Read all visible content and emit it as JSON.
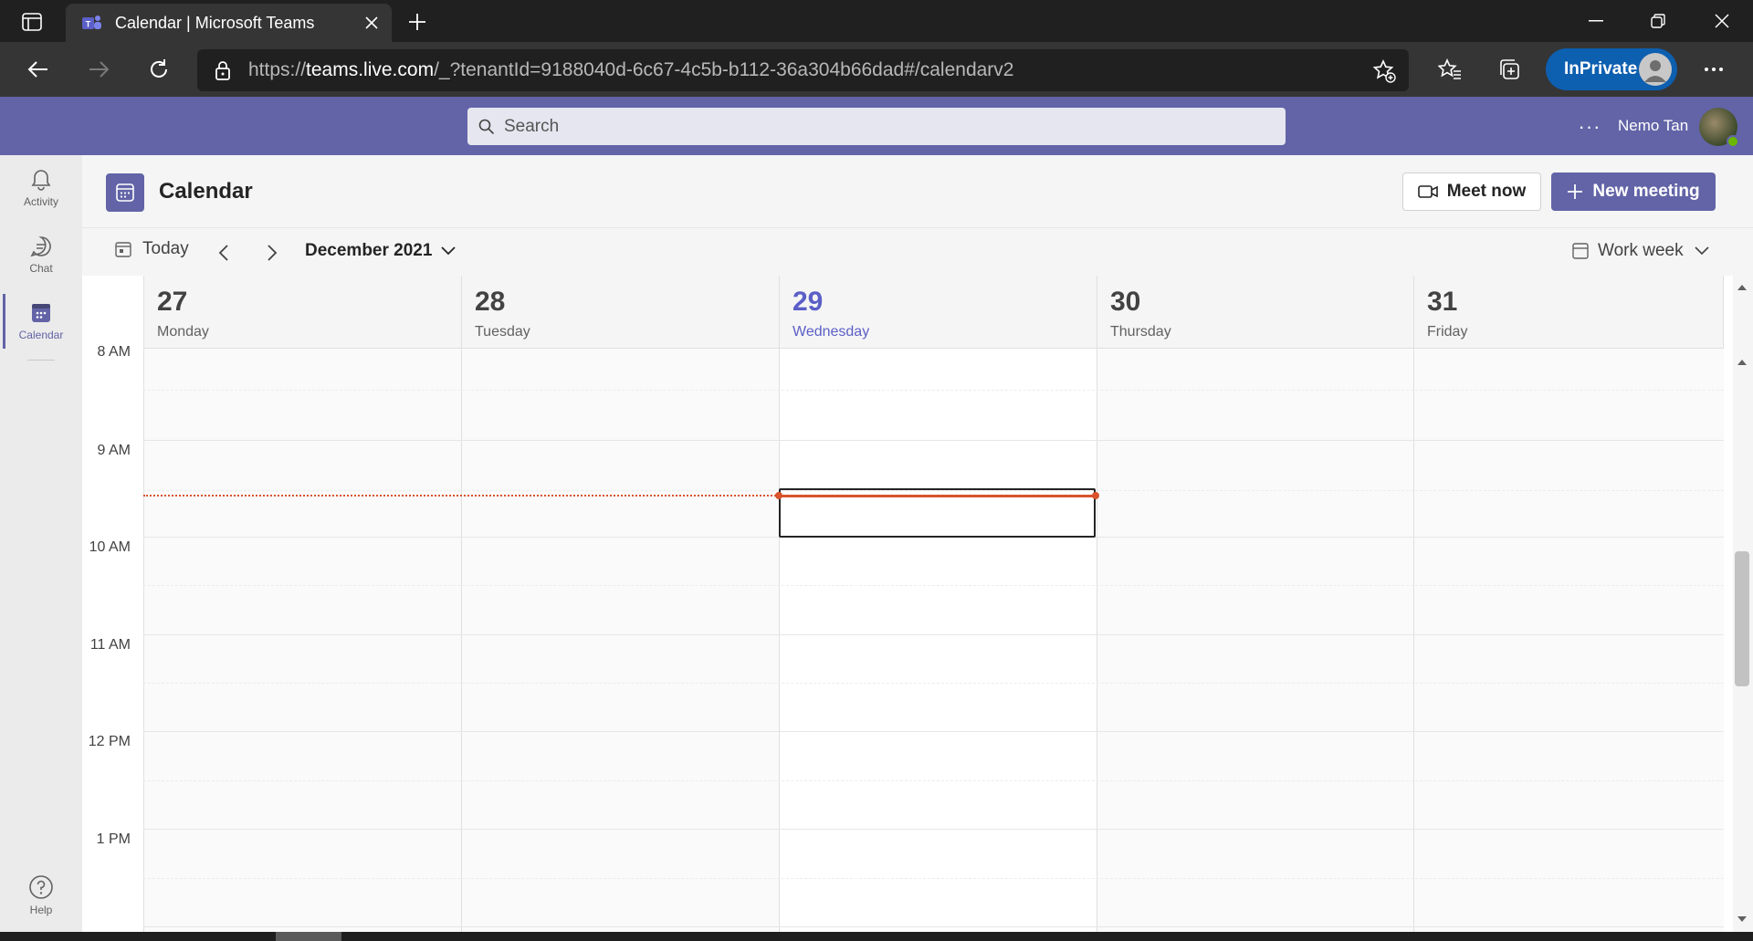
{
  "browser": {
    "tab_title": "Calendar | Microsoft Teams",
    "url_prefix": "https://",
    "url_host": "teams.live.com",
    "url_rest": "/_?tenantId=9188040d-6c67-4c5b-b112-36a304b66dad#/calendarv2",
    "inprivate_label": "InPrivate"
  },
  "teams": {
    "search_placeholder": "Search",
    "more_label": "···",
    "user_name": "Nemo Tan"
  },
  "rail": {
    "items": [
      {
        "label": "Activity",
        "icon": "bell-icon"
      },
      {
        "label": "Chat",
        "icon": "chat-icon"
      },
      {
        "label": "Calendar",
        "icon": "calendar-icon",
        "active": true
      }
    ],
    "help_label": "Help"
  },
  "calendar": {
    "title": "Calendar",
    "meet_now": "Meet now",
    "new_meeting": "New meeting",
    "today_label": "Today",
    "month_label": "December 2021",
    "view_label": "Work week",
    "days": [
      {
        "num": "27",
        "name": "Monday"
      },
      {
        "num": "28",
        "name": "Tuesday"
      },
      {
        "num": "29",
        "name": "Wednesday",
        "today": true
      },
      {
        "num": "30",
        "name": "Thursday"
      },
      {
        "num": "31",
        "name": "Friday"
      }
    ],
    "times": [
      "8 AM",
      "9 AM",
      "10 AM",
      "11 AM",
      "12 PM",
      "1 PM"
    ]
  },
  "colors": {
    "teams_purple": "#6264a7",
    "current_time": "#d9532c",
    "browser_dark": "#202020",
    "inprivate_blue": "#0d5fb0"
  }
}
